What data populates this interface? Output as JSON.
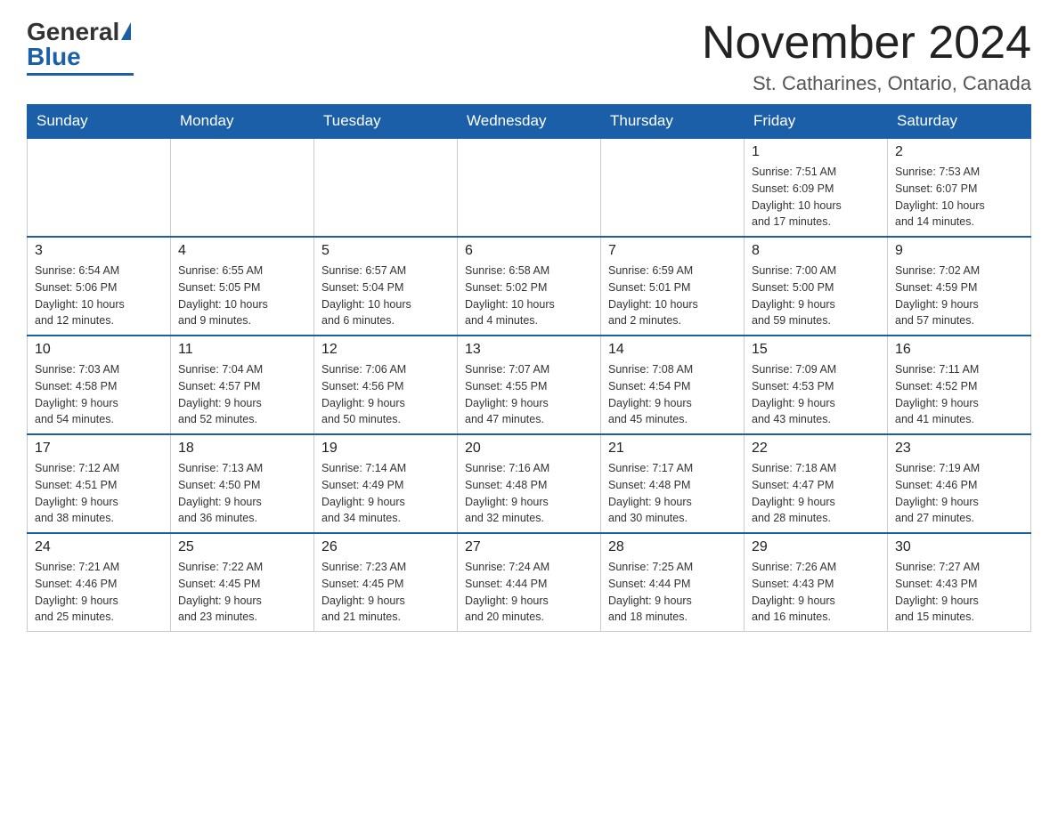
{
  "header": {
    "logo": {
      "general": "General",
      "blue": "Blue",
      "tagline": "GeneralBlue"
    },
    "title": "November 2024",
    "location": "St. Catharines, Ontario, Canada"
  },
  "days_of_week": [
    "Sunday",
    "Monday",
    "Tuesday",
    "Wednesday",
    "Thursday",
    "Friday",
    "Saturday"
  ],
  "weeks": [
    {
      "days": [
        {
          "date": "",
          "info": ""
        },
        {
          "date": "",
          "info": ""
        },
        {
          "date": "",
          "info": ""
        },
        {
          "date": "",
          "info": ""
        },
        {
          "date": "",
          "info": ""
        },
        {
          "date": "1",
          "info": "Sunrise: 7:51 AM\nSunset: 6:09 PM\nDaylight: 10 hours\nand 17 minutes."
        },
        {
          "date": "2",
          "info": "Sunrise: 7:53 AM\nSunset: 6:07 PM\nDaylight: 10 hours\nand 14 minutes."
        }
      ]
    },
    {
      "days": [
        {
          "date": "3",
          "info": "Sunrise: 6:54 AM\nSunset: 5:06 PM\nDaylight: 10 hours\nand 12 minutes."
        },
        {
          "date": "4",
          "info": "Sunrise: 6:55 AM\nSunset: 5:05 PM\nDaylight: 10 hours\nand 9 minutes."
        },
        {
          "date": "5",
          "info": "Sunrise: 6:57 AM\nSunset: 5:04 PM\nDaylight: 10 hours\nand 6 minutes."
        },
        {
          "date": "6",
          "info": "Sunrise: 6:58 AM\nSunset: 5:02 PM\nDaylight: 10 hours\nand 4 minutes."
        },
        {
          "date": "7",
          "info": "Sunrise: 6:59 AM\nSunset: 5:01 PM\nDaylight: 10 hours\nand 2 minutes."
        },
        {
          "date": "8",
          "info": "Sunrise: 7:00 AM\nSunset: 5:00 PM\nDaylight: 9 hours\nand 59 minutes."
        },
        {
          "date": "9",
          "info": "Sunrise: 7:02 AM\nSunset: 4:59 PM\nDaylight: 9 hours\nand 57 minutes."
        }
      ]
    },
    {
      "days": [
        {
          "date": "10",
          "info": "Sunrise: 7:03 AM\nSunset: 4:58 PM\nDaylight: 9 hours\nand 54 minutes."
        },
        {
          "date": "11",
          "info": "Sunrise: 7:04 AM\nSunset: 4:57 PM\nDaylight: 9 hours\nand 52 minutes."
        },
        {
          "date": "12",
          "info": "Sunrise: 7:06 AM\nSunset: 4:56 PM\nDaylight: 9 hours\nand 50 minutes."
        },
        {
          "date": "13",
          "info": "Sunrise: 7:07 AM\nSunset: 4:55 PM\nDaylight: 9 hours\nand 47 minutes."
        },
        {
          "date": "14",
          "info": "Sunrise: 7:08 AM\nSunset: 4:54 PM\nDaylight: 9 hours\nand 45 minutes."
        },
        {
          "date": "15",
          "info": "Sunrise: 7:09 AM\nSunset: 4:53 PM\nDaylight: 9 hours\nand 43 minutes."
        },
        {
          "date": "16",
          "info": "Sunrise: 7:11 AM\nSunset: 4:52 PM\nDaylight: 9 hours\nand 41 minutes."
        }
      ]
    },
    {
      "days": [
        {
          "date": "17",
          "info": "Sunrise: 7:12 AM\nSunset: 4:51 PM\nDaylight: 9 hours\nand 38 minutes."
        },
        {
          "date": "18",
          "info": "Sunrise: 7:13 AM\nSunset: 4:50 PM\nDaylight: 9 hours\nand 36 minutes."
        },
        {
          "date": "19",
          "info": "Sunrise: 7:14 AM\nSunset: 4:49 PM\nDaylight: 9 hours\nand 34 minutes."
        },
        {
          "date": "20",
          "info": "Sunrise: 7:16 AM\nSunset: 4:48 PM\nDaylight: 9 hours\nand 32 minutes."
        },
        {
          "date": "21",
          "info": "Sunrise: 7:17 AM\nSunset: 4:48 PM\nDaylight: 9 hours\nand 30 minutes."
        },
        {
          "date": "22",
          "info": "Sunrise: 7:18 AM\nSunset: 4:47 PM\nDaylight: 9 hours\nand 28 minutes."
        },
        {
          "date": "23",
          "info": "Sunrise: 7:19 AM\nSunset: 4:46 PM\nDaylight: 9 hours\nand 27 minutes."
        }
      ]
    },
    {
      "days": [
        {
          "date": "24",
          "info": "Sunrise: 7:21 AM\nSunset: 4:46 PM\nDaylight: 9 hours\nand 25 minutes."
        },
        {
          "date": "25",
          "info": "Sunrise: 7:22 AM\nSunset: 4:45 PM\nDaylight: 9 hours\nand 23 minutes."
        },
        {
          "date": "26",
          "info": "Sunrise: 7:23 AM\nSunset: 4:45 PM\nDaylight: 9 hours\nand 21 minutes."
        },
        {
          "date": "27",
          "info": "Sunrise: 7:24 AM\nSunset: 4:44 PM\nDaylight: 9 hours\nand 20 minutes."
        },
        {
          "date": "28",
          "info": "Sunrise: 7:25 AM\nSunset: 4:44 PM\nDaylight: 9 hours\nand 18 minutes."
        },
        {
          "date": "29",
          "info": "Sunrise: 7:26 AM\nSunset: 4:43 PM\nDaylight: 9 hours\nand 16 minutes."
        },
        {
          "date": "30",
          "info": "Sunrise: 7:27 AM\nSunset: 4:43 PM\nDaylight: 9 hours\nand 15 minutes."
        }
      ]
    }
  ]
}
